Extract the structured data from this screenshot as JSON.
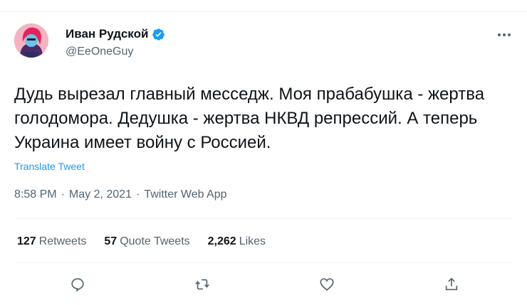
{
  "author": {
    "name": "Иван Рудской",
    "handle": "@EeOneGuy",
    "verified": true
  },
  "tweet": {
    "text": "Дудь вырезал главный месседж. Моя прабабушка - жертва голодомора. Дедушка - жертва НКВД репрессий. А теперь Украина имеет войну с Россией.",
    "translate_label": "Translate Tweet",
    "time": "8:58 PM",
    "date": "May 2, 2021",
    "source": "Twitter Web App",
    "separator": "·"
  },
  "stats": {
    "retweets_count": "127",
    "retweets_label": "Retweets",
    "quotes_count": "57",
    "quotes_label": "Quote Tweets",
    "likes_count": "2,262",
    "likes_label": "Likes"
  },
  "icons": {
    "more": "more-horizontal-icon",
    "reply": "reply-icon",
    "retweet": "retweet-icon",
    "like": "heart-icon",
    "share": "share-icon",
    "verified": "verified-badge-icon"
  },
  "colors": {
    "accent": "#1d9bf0",
    "text": "#0f1419",
    "secondary": "#536471",
    "divider": "#eff3f4"
  }
}
